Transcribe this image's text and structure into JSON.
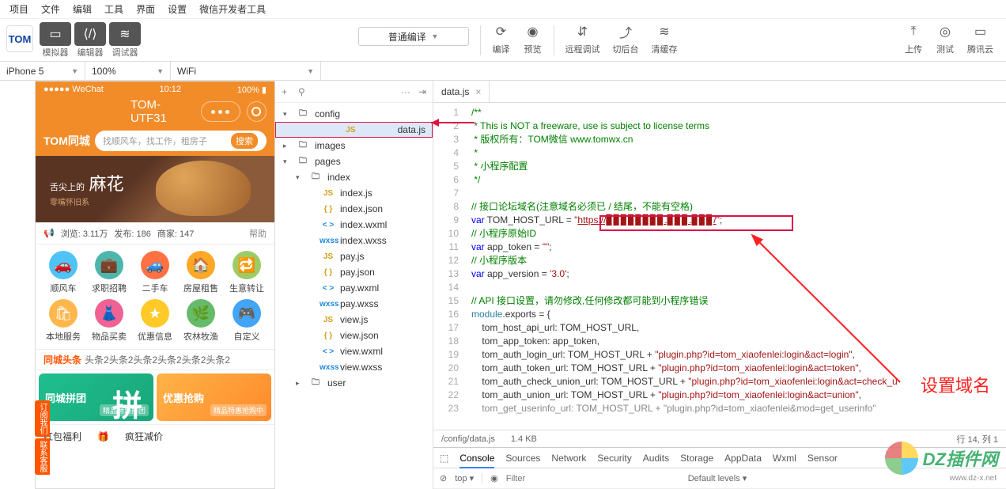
{
  "menu": [
    "项目",
    "文件",
    "编辑",
    "工具",
    "界面",
    "设置",
    "微信开发者工具"
  ],
  "toolbar": {
    "logo": "TOM",
    "sim": "模拟器",
    "editor": "编辑器",
    "debugger": "调试器",
    "compile_select": "普通编译",
    "compile": "编译",
    "preview": "预览",
    "remote": "远程调试",
    "cut": "切后台",
    "cache": "清缓存",
    "upload": "上传",
    "test": "测试",
    "cloud": "腾讯云"
  },
  "selectors": {
    "device": "iPhone 5",
    "zoom": "100%",
    "network": "WiFi"
  },
  "phone": {
    "status_left": "●●●●● WeChat",
    "wifi": "⌃",
    "time": "10:12",
    "battery": "100%",
    "title": "TOM-UTF31",
    "brand": "TOM同城",
    "search_placeholder": "找顺风车，找工作，租房子",
    "search_btn": "搜索",
    "banner_top": "舌尖上的",
    "banner_big": "麻花",
    "banner_sub": "零嘴怀旧系",
    "stats": {
      "views_lbl": "浏览:",
      "views": "3.11万",
      "pub_lbl": "发布:",
      "pub": "186",
      "shop_lbl": "商家:",
      "shop": "147",
      "help": "帮助"
    },
    "icons": [
      {
        "lbl": "顺风车",
        "bg": "#4fc3f7",
        "ch": "🚗"
      },
      {
        "lbl": "求职招聘",
        "bg": "#4db6ac",
        "ch": "💼"
      },
      {
        "lbl": "二手车",
        "bg": "#ff7043",
        "ch": "🚙"
      },
      {
        "lbl": "房屋租售",
        "bg": "#ffa726",
        "ch": "🏠"
      },
      {
        "lbl": "生意转让",
        "bg": "#9ccc65",
        "ch": "🔁"
      },
      {
        "lbl": "本地服务",
        "bg": "#ffb74d",
        "ch": "🛍"
      },
      {
        "lbl": "物品买卖",
        "bg": "#f06292",
        "ch": "👗"
      },
      {
        "lbl": "优惠信息",
        "bg": "#ffca28",
        "ch": "★"
      },
      {
        "lbl": "农林牧渔",
        "bg": "#66bb6a",
        "ch": "🌿"
      },
      {
        "lbl": "自定义",
        "bg": "#42a5f5",
        "ch": "🎮"
      }
    ],
    "headline_logo": "同城头条",
    "headline_text": "头条2头条2头条2头条2头条2头条2",
    "promo1": "同城拼团",
    "promo1_char": "拼",
    "promo1_badge": "精品特惠拼团",
    "promo2": "优惠抢购",
    "promo2_badge": "精品特惠抢购中",
    "side1": "订阅我们",
    "side2": "联系客服",
    "bottom": [
      "红包福利",
      "",
      "疯狂减价"
    ]
  },
  "tree": {
    "tools": {
      "add": "+",
      "search": "⚲",
      "more": "···",
      "collapse": "⇥"
    },
    "items": [
      {
        "name": "config",
        "type": "folder",
        "open": true,
        "ind": 0
      },
      {
        "name": "data.js",
        "type": "js",
        "ind": 1,
        "sel": true
      },
      {
        "name": "images",
        "type": "folder",
        "open": false,
        "ind": 0
      },
      {
        "name": "pages",
        "type": "folder",
        "open": true,
        "ind": 0
      },
      {
        "name": "index",
        "type": "folder",
        "open": true,
        "ind": 1
      },
      {
        "name": "index.js",
        "type": "js",
        "ind": 2
      },
      {
        "name": "index.json",
        "type": "json",
        "ind": 2
      },
      {
        "name": "index.wxml",
        "type": "wxml",
        "ind": 2
      },
      {
        "name": "index.wxss",
        "type": "wxss",
        "ind": 2
      },
      {
        "name": "pay.js",
        "type": "js",
        "ind": 2
      },
      {
        "name": "pay.json",
        "type": "json",
        "ind": 2
      },
      {
        "name": "pay.wxml",
        "type": "wxml",
        "ind": 2
      },
      {
        "name": "pay.wxss",
        "type": "wxss",
        "ind": 2
      },
      {
        "name": "view.js",
        "type": "js",
        "ind": 2
      },
      {
        "name": "view.json",
        "type": "json",
        "ind": 2
      },
      {
        "name": "view.wxml",
        "type": "wxml",
        "ind": 2
      },
      {
        "name": "view.wxss",
        "type": "wxss",
        "ind": 2
      },
      {
        "name": "user",
        "type": "folder",
        "open": false,
        "ind": 1
      }
    ]
  },
  "editor": {
    "tab": "data.js",
    "lines": [
      {
        "n": 1,
        "t": "/**",
        "c": "cgreen"
      },
      {
        "n": 2,
        "t": " * This is NOT a freeware, use is subject to license terms",
        "c": "cgreen"
      },
      {
        "n": 3,
        "t": " * 版权所有：TOM微信 www.tomwx.cn",
        "c": "cgreen"
      },
      {
        "n": 4,
        "t": " *",
        "c": "cgreen"
      },
      {
        "n": 5,
        "t": " * 小程序配置",
        "c": "cgreen"
      },
      {
        "n": 6,
        "t": " */",
        "c": "cgreen"
      },
      {
        "n": 7,
        "t": "",
        "c": ""
      },
      {
        "n": 8,
        "t": "// 接口论坛域名(注意域名必须已 / 结尾，不能有空格)",
        "c": "cgreen"
      },
      {
        "n": 9,
        "html": "<span class='cblue'>var</span> TOM_HOST_URL = <span class='cred'>\"<u>https://▊▊▊▊▊▊▊▊.▊▊▊.▊▊▊/</u>\"</span>;"
      },
      {
        "n": 10,
        "t": "// 小程序原始ID",
        "c": "cgreen"
      },
      {
        "n": 11,
        "html": "<span class='cblue'>var</span> app_token = <span class='cred'>\"\"</span>;"
      },
      {
        "n": 12,
        "t": "// 小程序版本",
        "c": "cgreen"
      },
      {
        "n": 13,
        "html": "<span class='cblue'>var</span> app_version = <span class='cred'>'3.0'</span>;"
      },
      {
        "n": 14,
        "t": "",
        "c": ""
      },
      {
        "n": 15,
        "t": "// API 接口设置，请勿修改,任何修改都可能到小程序错误",
        "c": "cgreen"
      },
      {
        "n": 16,
        "html": "<span class='cteal'>module</span>.exports = {"
      },
      {
        "n": 17,
        "t": "    tom_host_api_url: TOM_HOST_URL,",
        "c": ""
      },
      {
        "n": 18,
        "t": "    tom_app_token: app_token,",
        "c": ""
      },
      {
        "n": 19,
        "html": "    tom_auth_login_url: TOM_HOST_URL + <span class='cred'>\"plugin.php?id=tom_xiaofenlei:login&act=login\"</span>,"
      },
      {
        "n": 20,
        "html": "    tom_auth_token_url: TOM_HOST_URL + <span class='cred'>\"plugin.php?id=tom_xiaofenlei:login&act=token\"</span>,"
      },
      {
        "n": 21,
        "html": "    tom_auth_check_union_url: TOM_HOST_URL + <span class='cred'>\"plugin.php?id=tom_xiaofenlei:login&act=check_u</span>"
      },
      {
        "n": 22,
        "html": "    tom_auth_union_url: TOM_HOST_URL + <span class='cred'>\"plugin.php?id=tom_xiaofenlei:login&act=union\"</span>,"
      },
      {
        "n": 23,
        "html": "    <span class='cgray'>tom_get_userinfo_url: TOM_HOST_URL + \"plugin.php?id=tom_xiaofenlei&mod=get_userinfo\"</span>"
      }
    ],
    "status_path": "/config/data.js",
    "status_size": "1.4 KB",
    "status_pos": "行 14, 列 1",
    "annotation": "设置域名"
  },
  "devtools": {
    "tabs": [
      "Console",
      "Sources",
      "Network",
      "Security",
      "Audits",
      "Storage",
      "AppData",
      "Wxml",
      "Sensor"
    ],
    "top": "top",
    "filter_ph": "Filter",
    "levels": "Default levels"
  },
  "watermark": {
    "text": "DZ插件网",
    "sub": "www.dz-x.net"
  }
}
